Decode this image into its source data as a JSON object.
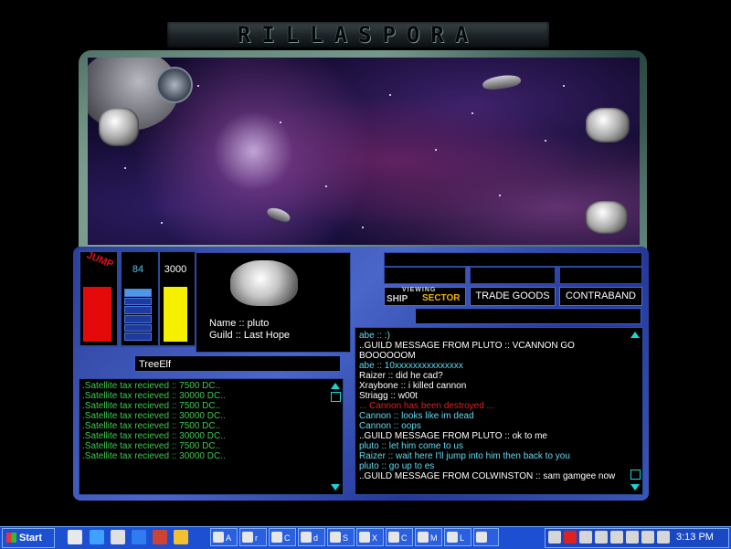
{
  "title": "RILLASPORA",
  "jump": {
    "label": "JUMP",
    "level": 0.88
  },
  "fuel": {
    "value": "84"
  },
  "credits": {
    "value": "3000",
    "level": 0.9
  },
  "player": {
    "name_line": "Name :: pluto",
    "guild_line": "Guild :: Last Hope",
    "selected_name": "TreeElf"
  },
  "system_log": [
    ".Satellite tax recieved :: 7500 DC..",
    ".Satellite tax recieved :: 30000 DC..",
    ".Satellite tax recieved :: 7500 DC..",
    ".Satellite tax recieved :: 30000 DC..",
    ".Satellite tax recieved :: 7500 DC..",
    ".Satellite tax recieved :: 30000 DC..",
    ".Satellite tax recieved :: 7500 DC..",
    ".Satellite tax recieved :: 30000 DC.."
  ],
  "view_toggle": {
    "viewing": "VIEWING",
    "ship": "SHIP",
    "sector": "SECTOR"
  },
  "buttons": {
    "trade_goods": "TRADE GOODS",
    "contraband": "CONTRABAND"
  },
  "chat": [
    {
      "text": "abe :: :)",
      "color": "cyan"
    },
    {
      "text": "..GUILD MESSAGE FROM PLUTO :: VCANNON GO",
      "color": "white"
    },
    {
      "text": " BOOOOOOM",
      "color": "white"
    },
    {
      "text": "abe :: 10xxxxxxxxxxxxxxx",
      "color": "cyan"
    },
    {
      "text": "Raizer :: did he cad?",
      "color": "white"
    },
    {
      "text": "Xraybone :: i killed cannon",
      "color": "white"
    },
    {
      "text": "Striagg :: w00t",
      "color": "white"
    },
    {
      "text": "... Cannon has been destroyed ...",
      "color": "red"
    },
    {
      "text": "Cannon :: looks like im dead",
      "color": "cyan"
    },
    {
      "text": "Cannon :: oops",
      "color": "cyan"
    },
    {
      "text": "..GUILD MESSAGE FROM PLUTO :: ok to me",
      "color": "white"
    },
    {
      "text": "pluto :: let him come to us",
      "color": "cyan"
    },
    {
      "text": "Raizer :: wait here I'll jump into him then back to you",
      "color": "cyan"
    },
    {
      "text": "pluto :: go up to es",
      "color": "cyan"
    },
    {
      "text": "..GUILD MESSAGE FROM COLWINSTON :: sam gamgee now",
      "color": "white"
    }
  ],
  "taskbar": {
    "start_label": "Start",
    "buttons": [
      "A",
      "r",
      "C",
      "d",
      "S",
      "X",
      "C",
      "M",
      "L",
      ""
    ],
    "clock": "3:13 PM"
  }
}
